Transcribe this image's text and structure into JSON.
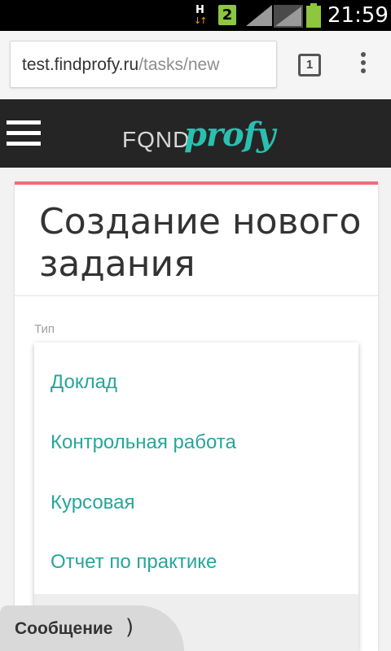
{
  "status_bar": {
    "network_type": "H",
    "network_arrows": "↓↑",
    "sim_number": "2",
    "time": "21:59",
    "battery_color": "#8dc63f"
  },
  "browser": {
    "url_host": "test.findprofy.ru",
    "url_path": "/tasks/new",
    "tab_count": "1",
    "menu_icon": "overflow-menu-icon"
  },
  "site_header": {
    "menu_icon": "hamburger-icon",
    "logo_find": "FQND",
    "logo_profy": "profy",
    "logo_color": "#2bbfb0",
    "background": "#252525"
  },
  "card": {
    "title": "Создание нового задания",
    "accent_color": "#ee6e73",
    "type_label": "Тип"
  },
  "dropdown": {
    "items": [
      {
        "label": "Доклад"
      },
      {
        "label": "Контрольная работа"
      },
      {
        "label": "Курсовая"
      },
      {
        "label": "Отчет по практике"
      },
      {
        "label": ""
      }
    ],
    "item_color": "#26a69a"
  },
  "message_tab": {
    "label": "Сообщение",
    "bracket": ")"
  }
}
